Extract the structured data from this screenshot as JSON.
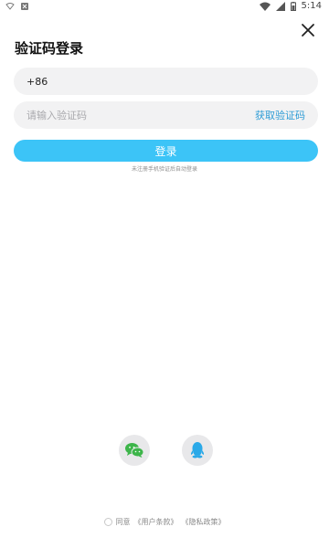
{
  "status_bar": {
    "time": "5:14"
  },
  "title": "验证码登录",
  "phone": {
    "prefix": "+86"
  },
  "code": {
    "placeholder": "请输入验证码",
    "get_code_label": "获取验证码"
  },
  "login_label": "登录",
  "hint": "未注册手机验证后自动登录",
  "agreement": {
    "prefix": "同意",
    "user_terms": "《用户条款》",
    "privacy_policy": "《隐私政策》"
  },
  "colors": {
    "accent": "#3cc4f7",
    "link": "#2d9cd6",
    "field_bg": "#f2f2f3"
  }
}
